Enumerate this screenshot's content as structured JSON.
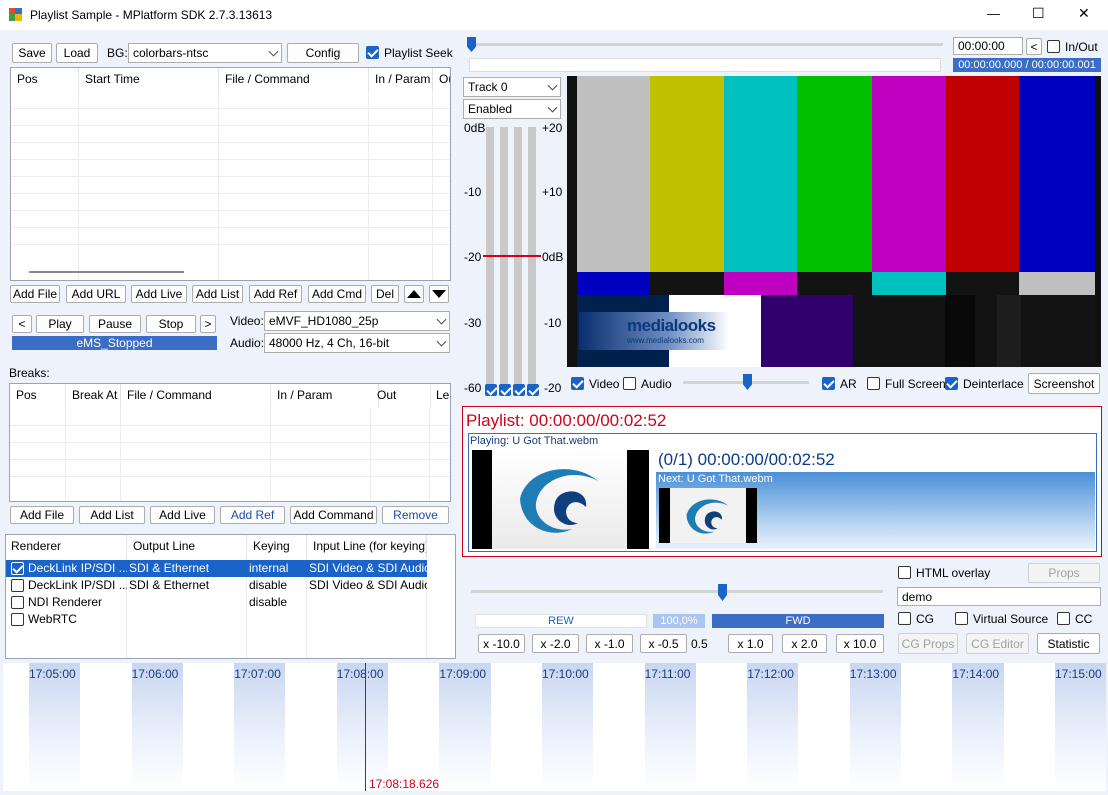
{
  "window": {
    "title": "Playlist Sample - MPlatform SDK 2.7.3.13613",
    "minimize": "—",
    "maximize": "☐",
    "close": "✕"
  },
  "toolbar": {
    "save": "Save",
    "load": "Load",
    "bg_label": "BG:",
    "bg_value": "colorbars-ntsc",
    "config": "Config",
    "playlist_seek": "Playlist Seek"
  },
  "playlist": {
    "columns": [
      "Pos",
      "Start Time",
      "File / Command",
      "In / Param",
      "Ou"
    ],
    "buttons": [
      "Add File",
      "Add URL",
      "Add Live",
      "Add List",
      "Add Ref",
      "Add Cmd",
      "Del"
    ]
  },
  "transport": {
    "prev": "<",
    "play": "Play",
    "pause": "Pause",
    "stop": "Stop",
    "next": ">",
    "status": "eMS_Stopped",
    "video_label": "Video:",
    "video_value": "eMVF_HD1080_25p",
    "audio_label": "Audio:",
    "audio_value": "48000 Hz, 4 Ch, 16-bit"
  },
  "breaks": {
    "title": "Breaks:",
    "columns": [
      "Pos",
      "Break At",
      "File / Command",
      "In / Param",
      "Out",
      "Le"
    ],
    "buttons": [
      "Add File",
      "Add List",
      "Add Live",
      "Add Ref",
      "Add Command",
      "Remove"
    ]
  },
  "renderers": {
    "columns": [
      "Renderer",
      "Output Line",
      "Keying",
      "Input Line (for keying)"
    ],
    "rows": [
      {
        "checked": true,
        "name": "DeckLink IP/SDI ...",
        "output": "SDI & Ethernet",
        "keying": "internal",
        "input": "SDI Video & SDI Audio",
        "selected": true
      },
      {
        "checked": false,
        "name": "DeckLink IP/SDI ...",
        "output": "SDI & Ethernet",
        "keying": "disable",
        "input": "SDI Video & SDI Audio",
        "selected": false
      },
      {
        "checked": false,
        "name": "NDI Renderer",
        "output": "",
        "keying": "disable",
        "input": "",
        "selected": false
      },
      {
        "checked": false,
        "name": "WebRTC",
        "output": "",
        "keying": "",
        "input": "",
        "selected": false
      }
    ]
  },
  "seek": {
    "time": "00:00:00",
    "prev": "<",
    "in_out": "In/Out",
    "position": "00:00:00.000 / 00:00:00.001",
    "position_pct": 0
  },
  "audio": {
    "track": "Track 0",
    "state": "Enabled",
    "left_scale": [
      "0dB",
      "-10",
      "-20",
      "-30",
      "-60"
    ],
    "right_scale": [
      "+20",
      "+10",
      "0dB",
      "-10",
      "-20"
    ]
  },
  "preview": {
    "logo_text": "medialooks",
    "logo_url": "www.medialooks.com"
  },
  "preview_options": {
    "video": "Video",
    "audio": "Audio",
    "ar": "AR",
    "full_screen": "Full Screen",
    "deinterlace": "Deinterlace",
    "screenshot": "Screenshot",
    "volume_pct": 50
  },
  "playlist_status": {
    "header": "Playlist: 00:00:00/00:02:52",
    "playing": "Playing: U Got That.webm",
    "counter": "(0/1) 00:00:00/00:02:52",
    "next": "Next: U Got That.webm"
  },
  "rate": {
    "rew": "REW",
    "pct": "100,0%",
    "fwd": "FWD",
    "speed_pct": 50,
    "buttons": [
      "x -10.0",
      "x -2.0",
      "x -1.0",
      "x -0.5",
      "0.5",
      "x 1.0",
      "x 2.0",
      "x 10.0"
    ]
  },
  "cg": {
    "html_overlay": "HTML overlay",
    "props": "Props",
    "demo": "demo",
    "cg": "CG",
    "virtual_source": "Virtual Source",
    "cc": "CC",
    "cg_props": "CG Props",
    "cg_editor": "CG Editor",
    "statistic": "Statistic"
  },
  "timeline": {
    "ticks": [
      "17:05:00",
      "17:06:00",
      "17:07:00",
      "17:08:00",
      "17:09:00",
      "17:10:00",
      "17:11:00",
      "17:12:00",
      "17:13:00",
      "17:14:00",
      "17:15:00"
    ],
    "cursor": "17:08:18.626"
  },
  "colors": {
    "accent": "#1a63c9",
    "status_bar": "#3c6dc4",
    "red": "#d0021b"
  }
}
